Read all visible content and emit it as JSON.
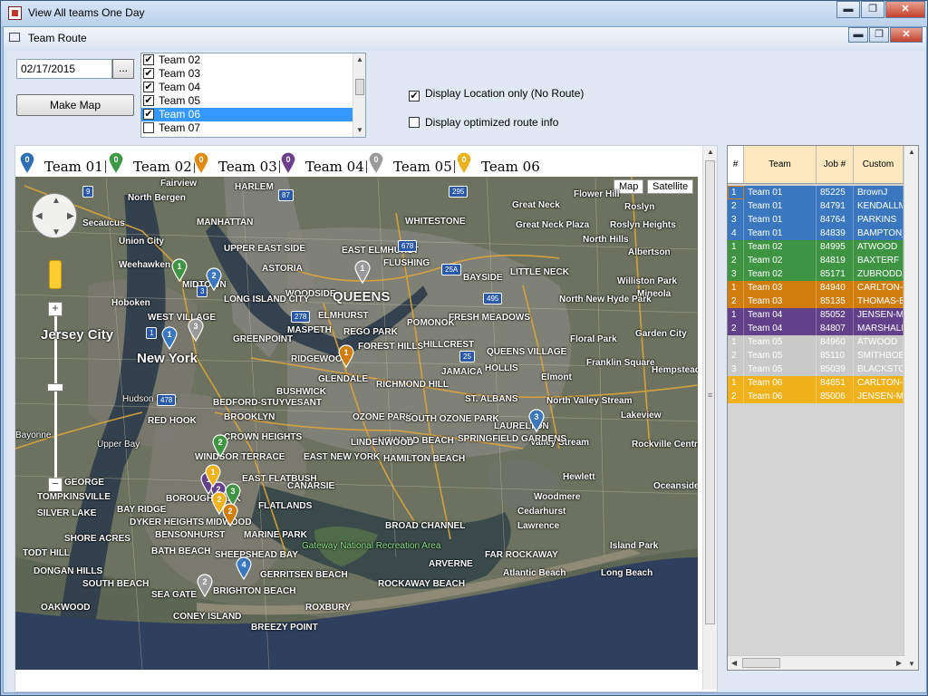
{
  "outer_window": {
    "title": "View All teams One Day",
    "min_label": "▬",
    "max_label": "❐",
    "close_label": "✕"
  },
  "inner_window": {
    "title": "Team Route",
    "min_label": "▬",
    "max_label": "❐",
    "close_label": "✕"
  },
  "controls": {
    "date": "02/17/2015",
    "date_button": "...",
    "make_map_button": "Make Map",
    "team_list": [
      {
        "label": "Team 02",
        "checked": true,
        "selected": false
      },
      {
        "label": "Team 03",
        "checked": true,
        "selected": false
      },
      {
        "label": "Team 04",
        "checked": true,
        "selected": false
      },
      {
        "label": "Team 05",
        "checked": true,
        "selected": false
      },
      {
        "label": "Team 06",
        "checked": true,
        "selected": true
      },
      {
        "label": "Team 07",
        "checked": false,
        "selected": false
      }
    ],
    "display_location_only": {
      "label": "Display Location only (No Route)",
      "checked": true
    },
    "display_optimized": {
      "label": "Display optimized route info",
      "checked": false
    }
  },
  "legend": [
    {
      "label": "Team 01",
      "color": "#2f6fb3",
      "num": "0"
    },
    {
      "label": "Team 02",
      "color": "#3c9a45",
      "num": "0"
    },
    {
      "label": "Team 03",
      "color": "#e08a12",
      "num": "0"
    },
    {
      "label": "Team 04",
      "color": "#6b3f8c",
      "num": "0"
    },
    {
      "label": "Team 05",
      "color": "#9a9a9a",
      "num": "0"
    },
    {
      "label": "Team 06",
      "color": "#e8b21c",
      "num": "0"
    }
  ],
  "map": {
    "type_buttons": [
      "Map",
      "Satellite"
    ],
    "zoom_plus": "+",
    "zoom_minus": "−",
    "labels": [
      "Fairview",
      "North Bergen",
      "Secaucus",
      "Union City",
      "Weehawken",
      "Hoboken",
      "Jersey City",
      "New York",
      "MANHATTAN",
      "HARLEM",
      "UPPER EAST SIDE",
      "MIDTOWN",
      "WEST VILLAGE",
      "GREENPOINT",
      "BROOKLYN",
      "RED HOOK",
      "BEDFORD-STUYVESANT",
      "BUSHWICK",
      "WINDSOR TERRACE",
      "EAST FLATBUSH",
      "BOROUGH PARK",
      "FLATLANDS",
      "MIDWOOD",
      "MARINE PARK",
      "BENSONHURST",
      "BATH BEACH",
      "SHEEPSHEAD BAY",
      "GERRITSEN BEACH",
      "BRIGHTON BEACH",
      "SEA GATE",
      "CONEY ISLAND",
      "ASTORIA",
      "WOODSIDE",
      "QUEENS",
      "MASPETH",
      "ELMHURST",
      "EAST ELMHURST",
      "FLUSHING",
      "WHITESTONE",
      "BAYSIDE",
      "LITTLE NECK",
      "Great Neck",
      "Great Neck Plaza",
      "Roslyn",
      "Roslyn Heights",
      "North Hills",
      "Albertson",
      "Williston Park",
      "Mineola",
      "North New Hyde Park",
      "Floral Park",
      "Garden City",
      "Franklin Square",
      "Hempstead",
      "Elmont",
      "North Valley Stream",
      "Valley Stream",
      "Lakeview",
      "Rockville Centre",
      "Hewlett",
      "Oceanside",
      "Woodmere",
      "Cedarhurst",
      "Lawrence",
      "Island Park",
      "Long Beach",
      "Atlantic Beach",
      "FAR ROCKAWAY",
      "ARVERNE",
      "BROAD CHANNEL",
      "ROCKAWAY BEACH",
      "ROXBURY",
      "BREEZY POINT",
      "Gateway National Recreation Area",
      "FOREST HILLS",
      "RIDGEWOOD",
      "GLENDALE",
      "RICHMOND HILL",
      "JAMAICA",
      "HOLLIS",
      "QUEENS VILLAGE",
      "ST. ALBANS",
      "LAURELTON",
      "SPRINGFIELD GARDENS",
      "OZONE PARK",
      "SOUTH OZONE PARK",
      "HOWARD BEACH",
      "HAMILTON BEACH",
      "LINDENWOOD",
      "EAST NEW YORK",
      "CROWN HEIGHTS",
      "CANARSIE",
      "REGO PARK",
      "POMONOK",
      "FRESH MEADOWS",
      "HILLCREST",
      "BAY RIDGE",
      "DYKER HEIGHTS",
      "SOUTH BEACH",
      "OAKWOOD",
      "DONGAN HILLS",
      "SHORE ACRES",
      "TODT HILL",
      "SILVER LAKE",
      "GEORGE",
      "TOMPKINSVILLE",
      "Bayonne",
      "Upper Bay",
      "Hudson River",
      "Flower Hill",
      "LONG ISLAND CITY"
    ],
    "shields": [
      "295",
      "678",
      "495",
      "278",
      "25A",
      "25",
      "87",
      "9",
      "3",
      "478",
      "1"
    ]
  },
  "grid": {
    "columns": [
      "#",
      "Team",
      "Job #",
      "Custom"
    ],
    "rows": [
      {
        "num": "1",
        "team": "Team 01",
        "job": "85225",
        "customer": "BrownJ",
        "color": "#3a77be"
      },
      {
        "num": "2",
        "team": "Team 01",
        "job": "84791",
        "customer": "KENDALLM",
        "color": "#3a77be"
      },
      {
        "num": "3",
        "team": "Team 01",
        "job": "84764",
        "customer": "PARKINS",
        "color": "#3a77be"
      },
      {
        "num": "4",
        "team": "Team 01",
        "job": "84839",
        "customer": "BAMPTON_",
        "color": "#3a77be"
      },
      {
        "num": "1",
        "team": "Team 02",
        "job": "84995",
        "customer": "ATWOOD",
        "color": "#3f9444"
      },
      {
        "num": "2",
        "team": "Team 02",
        "job": "84819",
        "customer": "BAXTERF",
        "color": "#3f9444"
      },
      {
        "num": "3",
        "team": "Team 02",
        "job": "85171",
        "customer": "ZUBRODDA",
        "color": "#3f9444"
      },
      {
        "num": "1",
        "team": "Team 03",
        "job": "84940",
        "customer": "CARLTON-K",
        "color": "#d07d0e"
      },
      {
        "num": "2",
        "team": "Team 03",
        "job": "85135",
        "customer": "THOMAS-Bi",
        "color": "#d07d0e"
      },
      {
        "num": "1",
        "team": "Team 04",
        "job": "85052",
        "customer": "JENSEN-M",
        "color": "#63418a"
      },
      {
        "num": "2",
        "team": "Team 04",
        "job": "84807",
        "customer": "MARSHALL",
        "color": "#63418a"
      },
      {
        "num": "1",
        "team": "Team 05",
        "job": "84960",
        "customer": "ATWOOD",
        "color": "#c9c9c9"
      },
      {
        "num": "2",
        "team": "Team 05",
        "job": "85110",
        "customer": "SMITHBOB",
        "color": "#c9c9c9"
      },
      {
        "num": "3",
        "team": "Team 05",
        "job": "85039",
        "customer": "BLACKSTO",
        "color": "#c9c9c9"
      },
      {
        "num": "1",
        "team": "Team 06",
        "job": "84851",
        "customer": "CARLTON-K",
        "color": "#f0b21b"
      },
      {
        "num": "2",
        "team": "Team 06",
        "job": "85006",
        "customer": "JENSEN-M",
        "color": "#f0b21b"
      }
    ]
  }
}
